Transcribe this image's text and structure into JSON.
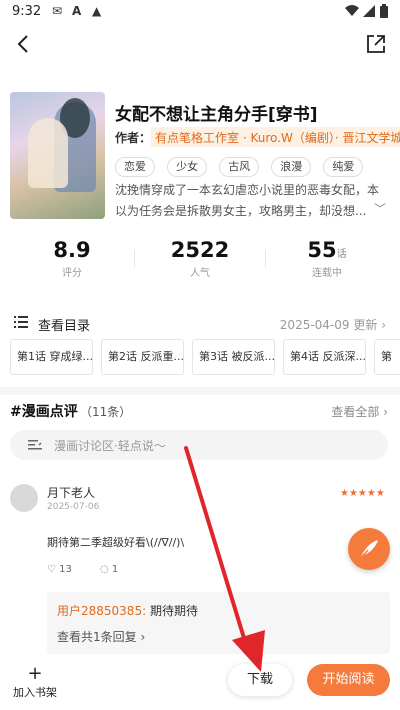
{
  "status_bar": {
    "time": "9:32",
    "icons": [
      "mail-icon",
      "a-icon",
      "warning-icon",
      "wifi-icon",
      "signal-icon",
      "battery-icon"
    ]
  },
  "comic": {
    "title": "女配不想让主角分手[穿书]",
    "author_label": "作者：",
    "authors": "有点笔格工作室 · Kuro.W（编剧）· 晋江文学城",
    "tags": [
      "恋爱",
      "少女",
      "古风",
      "浪漫",
      "纯爱"
    ],
    "description": "沈挽情穿成了一本玄幻虐恋小说里的恶毒女配，本以为任务会是拆散男女主，攻略男主，却没想..."
  },
  "stats": {
    "rating": {
      "value": "8.9",
      "label": "评分"
    },
    "popularity": {
      "value": "2522",
      "label": "人气"
    },
    "chapters": {
      "value": "55",
      "unit": "话",
      "label": "连载中"
    }
  },
  "catalog": {
    "label": "查看目录",
    "date": "2025-04-09 更新",
    "chapters": [
      "第1话 穿成绿...",
      "第2话 反派重...",
      "第3话 被反派...",
      "第4话 反派深...",
      "第"
    ]
  },
  "reviews": {
    "title": "#漫画点评",
    "count": "（11条）",
    "view_all": "查看全部",
    "search_placeholder": "漫画讨论区·轻点说～",
    "items": [
      {
        "user": "月下老人",
        "date": "2025-07-06",
        "stars": "★★★★★",
        "text": "期待第二季超级好看\\(//∇//)\\",
        "likes": "13",
        "comments": "1",
        "reply": {
          "user": "用户28850385:",
          "text": " 期待期待"
        },
        "view_replies": "查看共1条回复"
      }
    ]
  },
  "bottom_bar": {
    "add_shelf": "加入书架",
    "download": "下载",
    "start_reading": "开始阅读"
  },
  "colors": {
    "accent": "#f47b3c",
    "author_text": "#e06a1a",
    "arrow": "#e0262a"
  }
}
